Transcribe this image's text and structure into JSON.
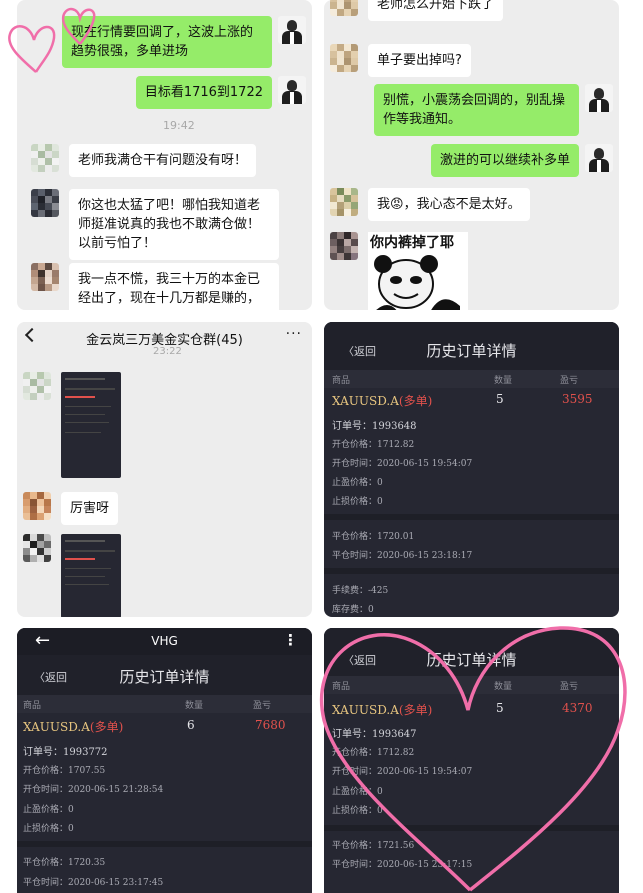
{
  "panel1": {
    "messages": [
      {
        "side": "right",
        "text": "现在行情要回调了，这波上涨的趋势很强，多单进场"
      },
      {
        "side": "right",
        "text": "目标看1716到1722"
      },
      {
        "side": "left",
        "text": "老师我满仓干有问题没有呀！"
      },
      {
        "side": "left",
        "text": "你这也太猛了吧！哪怕我知道老师挺准说真的我也不敢满仓做！以前亏怕了！"
      },
      {
        "side": "left",
        "text": "我一点不慌，我三十万的本金已经出了，现在十几万都是赚的，"
      }
    ],
    "time": "19:42",
    "emoji": "😆"
  },
  "panel2": {
    "messages": [
      {
        "side": "left",
        "text": "老师怎么开始下跌了"
      },
      {
        "side": "left",
        "text": "单子要出掉吗?"
      },
      {
        "side": "right",
        "text": "别慌，小震荡会回调的，别乱操作等我通知。"
      },
      {
        "side": "right",
        "text": "激进的可以继续补多单"
      },
      {
        "side": "left",
        "text": "我刚出了，我心态不是太好。"
      }
    ],
    "sticker_caption": "你内裤掉了耶",
    "emoji": "😡"
  },
  "panel3": {
    "back_icon": "chevron-left-icon",
    "title": "金云岚三万美金实仓群(45)",
    "more_icon": "ellipsis-icon",
    "time": "23:22",
    "message": "厉害呀"
  },
  "panel4": {
    "back": "〈返回",
    "title": "历史订单详情",
    "headers": [
      "商品",
      "数量",
      "盈亏"
    ],
    "symbol": "XAUUSD.A",
    "direction": "(多单)",
    "qty": "5",
    "pnl": "3595",
    "order_no": "订单号：1993648",
    "open_price": "开仓价格：1712.82",
    "open_time": "开仓时间：2020-06-15 19:54:07",
    "tp": "止盈价格：0",
    "sl": "止损价格：0",
    "close_price": "平仓价格：1720.01",
    "close_time": "平仓时间：2020-06-15 23:18:17",
    "fee": "手续费：-425",
    "swap": "库存费：0"
  },
  "panel5": {
    "app_title": "VHG",
    "back_icon": "arrow-left-icon",
    "menu_icon": "vertical-dots-icon",
    "back": "〈返回",
    "title": "历史订单详情",
    "headers": [
      "商品",
      "数量",
      "盈亏"
    ],
    "symbol": "XAUUSD.A",
    "direction": "(多单)",
    "qty": "6",
    "pnl": "7680",
    "order_no": "订单号：1993772",
    "open_price": "开仓价格：1707.55",
    "open_time": "开仓时间：2020-06-15 21:28:54",
    "tp": "止盈价格：0",
    "sl": "止损价格：0",
    "close_price": "平仓价格：1720.35",
    "close_time": "平仓时间：2020-06-15 23:17:45"
  },
  "panel6": {
    "back": "〈返回",
    "title": "历史订单详情",
    "headers": [
      "商品",
      "数量",
      "盈亏"
    ],
    "symbol": "XAUUSD.A",
    "direction": "(多单)",
    "qty": "5",
    "pnl": "4370",
    "order_no": "订单号：1993647",
    "open_price": "开仓价格：1712.82",
    "open_time": "开仓时间：2020-06-15 19:54:07",
    "tp": "止盈价格：0",
    "sl": "止损价格：0",
    "close_price": "平仓价格：1721.56",
    "close_time": "平仓时间：2020-06-15 23:17:15"
  },
  "colors": {
    "bubble_green": "#95ec69",
    "chat_bg": "#ededed",
    "dark_bg": "#262732",
    "profit_red": "#e0514c",
    "symbol_gold": "#e8c680",
    "doodle_pink": "#f06ea9"
  }
}
